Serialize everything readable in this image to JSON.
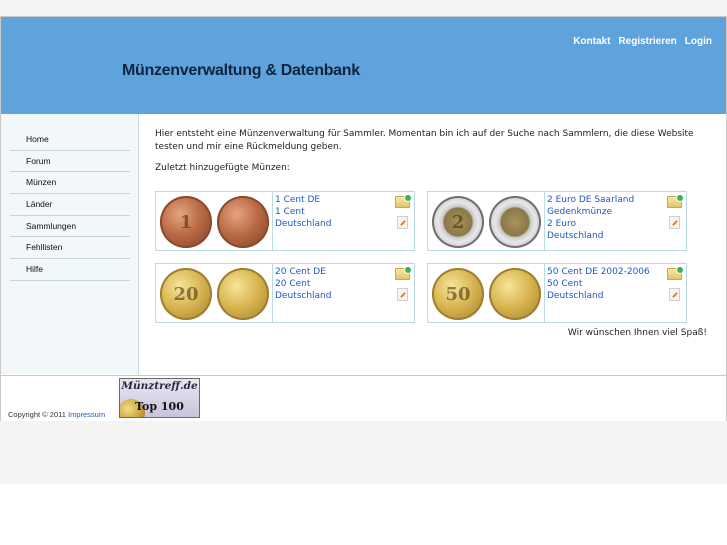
{
  "header": {
    "title": "Münzenverwaltung & Datenbank",
    "top_nav": [
      {
        "label": "Kontakt"
      },
      {
        "label": "Registrieren"
      },
      {
        "label": "Login"
      }
    ]
  },
  "sidebar": {
    "items": [
      {
        "label": "Home"
      },
      {
        "label": "Forum"
      },
      {
        "label": "Münzen"
      },
      {
        "label": "Länder"
      },
      {
        "label": "Sammlungen"
      },
      {
        "label": "Fehllisten"
      },
      {
        "label": "Hilfe"
      }
    ]
  },
  "main": {
    "intro": "Hier entsteht eine Münzenverwaltung für Sammler. Momentan bin ich auf der Suche nach Sammlern, die diese Website testen und mir eine Rückmeldung geben.",
    "recent_label": "Zuletzt hinzugefügte Münzen:",
    "coins": [
      {
        "name": "1 Cent DE",
        "denomination": "1 Cent",
        "country": "Deutschland",
        "metal": "copper",
        "face": "1"
      },
      {
        "name": "2 Euro DE Saarland Gedenkmünze",
        "denomination": "2 Euro",
        "country": "Deutschland",
        "metal": "bimetal",
        "face": "2"
      },
      {
        "name": "20 Cent DE",
        "denomination": "20 Cent",
        "country": "Deutschland",
        "metal": "nordic",
        "face": "20"
      },
      {
        "name": "50 Cent DE 2002-2006",
        "denomination": "50 Cent",
        "country": "Deutschland",
        "metal": "nordic",
        "face": "50"
      }
    ],
    "closing": "Wir wünschen Ihnen viel Spaß!"
  },
  "footer": {
    "copyright": "Copyright © 2011",
    "impressum": "Impressum",
    "badge_line1": "Münztreff.de",
    "badge_line2": "Top 100"
  },
  "colors": {
    "header_bg": "#5fa3dc",
    "link": "#1f56c9",
    "card_border": "#b9dbe4"
  },
  "icons": {
    "add_to_collection": "folder-add-icon",
    "edit": "edit-icon"
  }
}
